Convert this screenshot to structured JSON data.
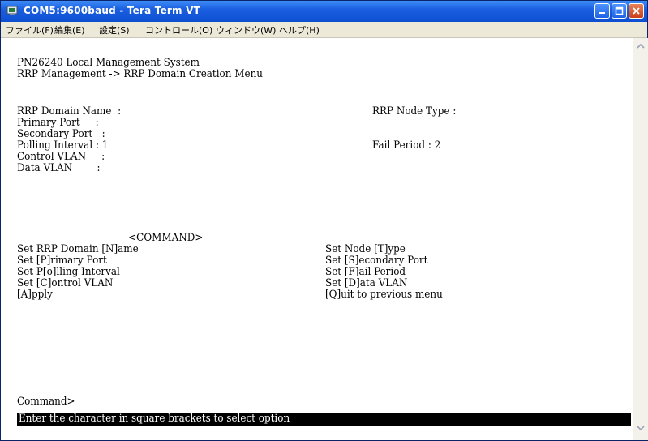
{
  "window": {
    "title": "COM5:9600baud - Tera Term VT"
  },
  "menu": {
    "items": [
      "ファイル(F)",
      "編集(E)",
      "設定(S)",
      "コントロール(O)",
      "ウィンドウ(W)",
      "ヘルプ(H)"
    ]
  },
  "terminal": {
    "header1": "PN26240 Local Management System",
    "header2": "RRP Management -> RRP Domain Creation Menu",
    "fields": {
      "domain_name_label": "RRP Domain Name  :",
      "node_type_label": "RRP Node Type :",
      "primary_port_label": "Primary Port     :",
      "secondary_port_label": "Secondary Port   :",
      "polling_interval_label": "Polling Interval : 1",
      "fail_period_label": "Fail Period : 2",
      "control_vlan_label": "Control VLAN     :",
      "data_vlan_label": "Data VLAN        :"
    },
    "command_divider": "--------------------------------- <COMMAND> ---------------------------------",
    "commands_left": [
      "Set RRP Domain [N]ame",
      "Set [P]rimary Port",
      "Set P[o]lling Interval",
      "Set [C]ontrol VLAN",
      "[A]pply"
    ],
    "commands_right": [
      "Set Node [T]ype",
      "Set [S]econdary Port",
      "Set [F]ail Period",
      "Set [D]ata VLAN",
      "[Q]uit to previous menu"
    ],
    "prompt": "Command>",
    "status_message": "Enter the character in square brackets to select option"
  }
}
